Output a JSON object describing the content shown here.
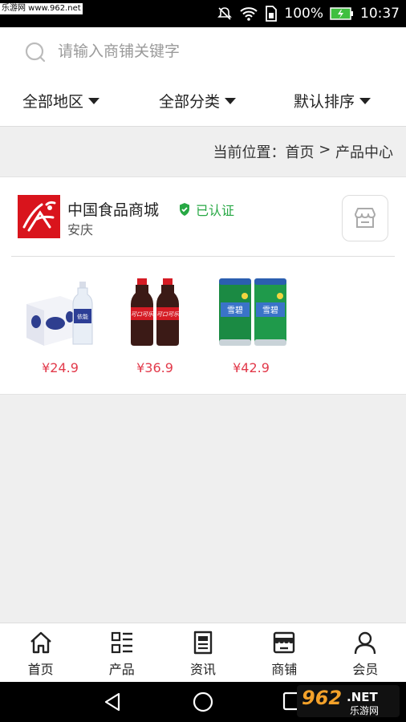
{
  "status_bar": {
    "watermark": "乐游网 www.962.net",
    "battery": "100%",
    "time": "10:37"
  },
  "search": {
    "placeholder": "请输入商铺关键字"
  },
  "filters": [
    {
      "label": "全部地区"
    },
    {
      "label": "全部分类"
    },
    {
      "label": "默认排序"
    }
  ],
  "breadcrumb": {
    "prefix": "当前位置：",
    "home": "首页",
    "separator": " > ",
    "current": "产品中心"
  },
  "shop": {
    "name": "中国食品商城",
    "verified_label": "已认证",
    "city": "安庆",
    "products": [
      {
        "price": "¥24.9",
        "icon": "water-bottles-image"
      },
      {
        "price": "¥36.9",
        "icon": "coca-cola-bottles-image"
      },
      {
        "price": "¥42.9",
        "icon": "sprite-cans-image"
      }
    ]
  },
  "bottom_nav": [
    {
      "label": "首页",
      "icon": "home-icon"
    },
    {
      "label": "产品",
      "icon": "product-list-icon"
    },
    {
      "label": "资讯",
      "icon": "news-icon"
    },
    {
      "label": "商铺",
      "icon": "store-icon"
    },
    {
      "label": "会员",
      "icon": "user-icon"
    }
  ],
  "watermark_br": "962.NET 乐游网",
  "colors": {
    "price": "#e23a4b",
    "verified": "#27a844",
    "logo_bg": "#d9141c"
  }
}
